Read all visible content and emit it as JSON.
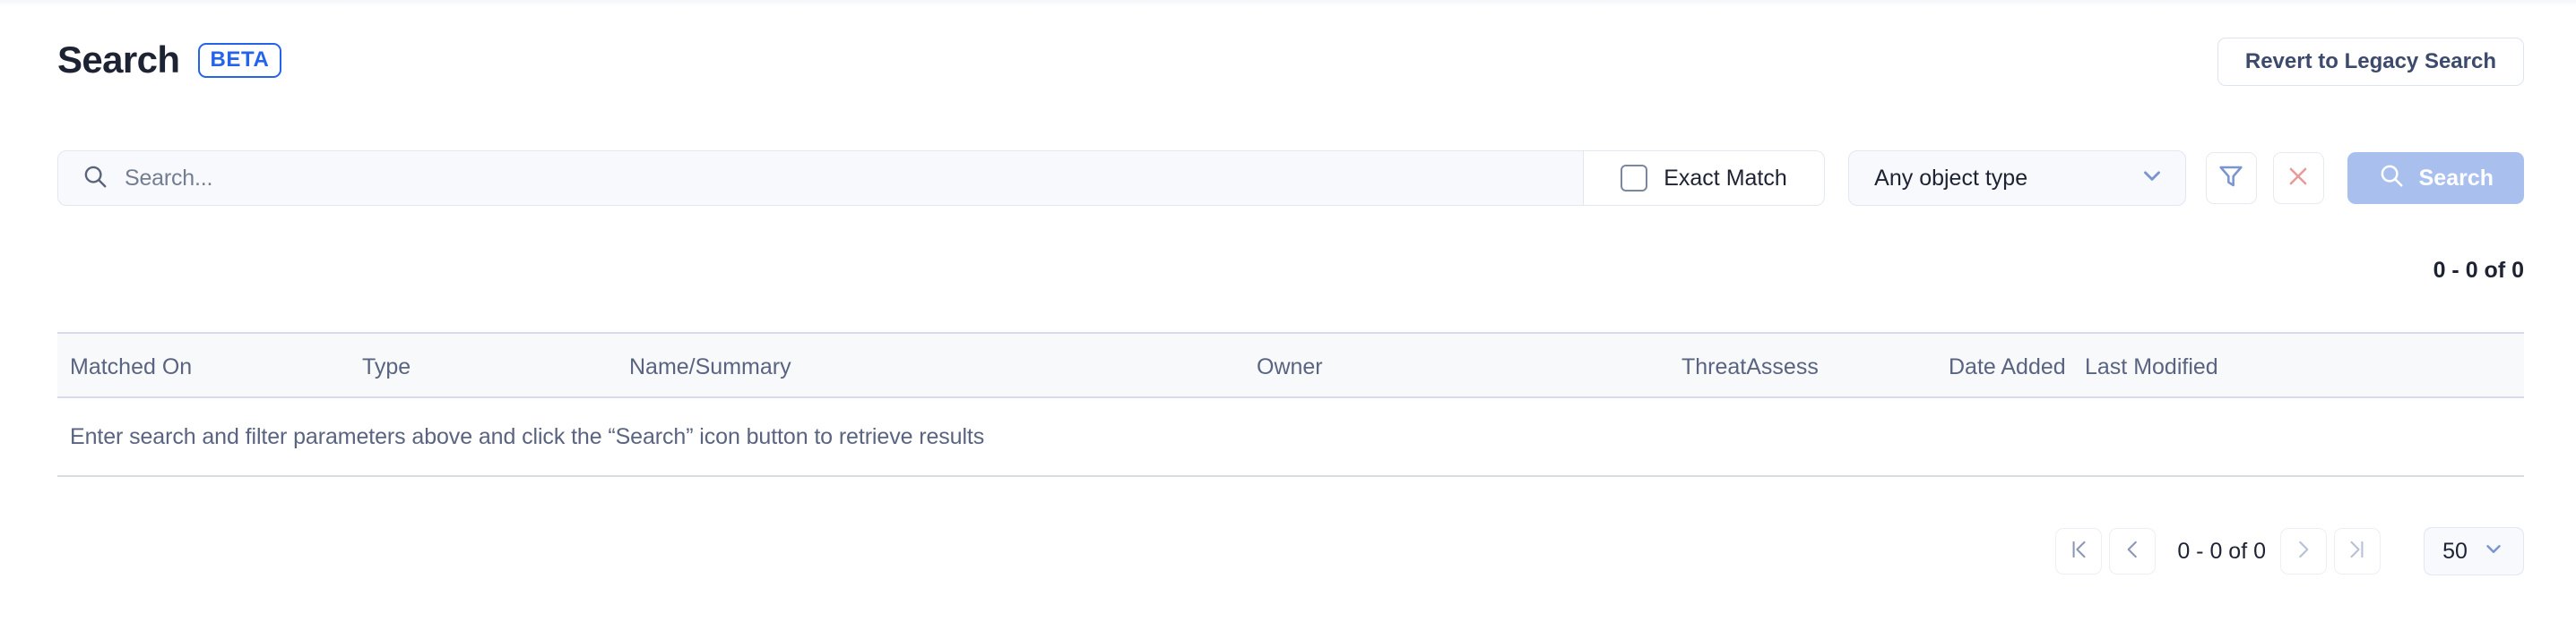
{
  "header": {
    "title": "Search",
    "badge": "BETA",
    "legacy_button": "Revert to Legacy Search"
  },
  "search": {
    "placeholder": "Search...",
    "value": "",
    "exact_match_label": "Exact Match",
    "exact_match_checked": false,
    "object_type_value": "Any object type",
    "filter_icon": "filter-funnel-icon",
    "clear_icon": "close-x-icon",
    "search_button_label": "Search",
    "search_icon": "search-magnifier-icon"
  },
  "results": {
    "count_top": "0 - 0 of 0",
    "columns": [
      "Matched On",
      "Type",
      "Name/Summary",
      "Owner",
      "ThreatAssess",
      "Date Added",
      "Last Modified"
    ],
    "empty_message": "Enter search and filter parameters above and click the “Search” icon button to retrieve results"
  },
  "pagination": {
    "first_icon": "first-page-icon",
    "prev_icon": "prev-page-icon",
    "range": "0 - 0 of 0",
    "next_icon": "next-page-icon",
    "last_icon": "last-page-icon",
    "page_size": "50"
  },
  "colors": {
    "accent_blue": "#2563eb",
    "muted_blue": "#a9c0ef",
    "icon_blue": "#7a95cf",
    "clear_red": "#e79a97",
    "text_dark": "#1d2333",
    "text_muted": "#5a6480",
    "border": "#d6dbe8"
  }
}
